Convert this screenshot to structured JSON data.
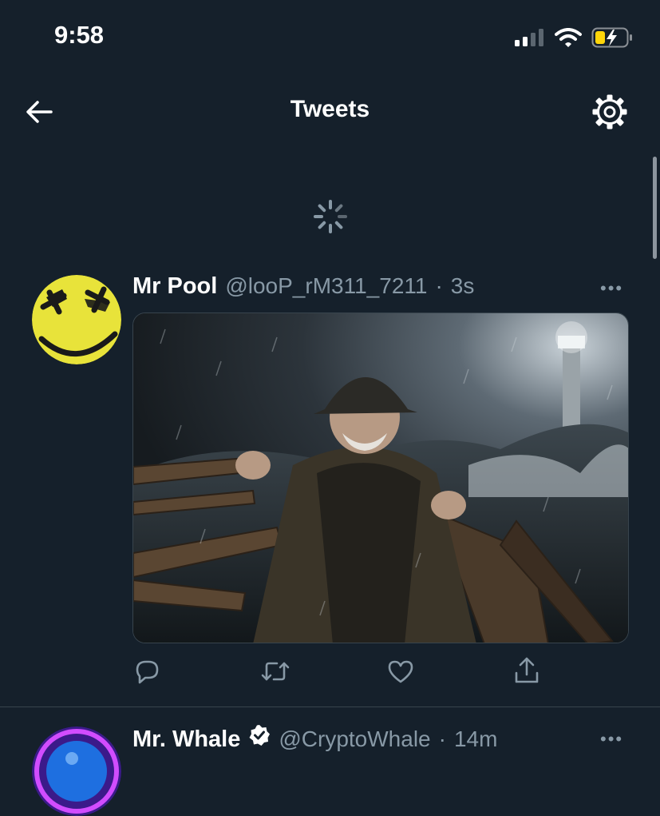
{
  "status_bar": {
    "time": "9:58",
    "signal_icon": "signal-bars-icon",
    "wifi_icon": "wifi-icon",
    "battery_icon": "battery-charging-icon",
    "battery_color": "#ffd60a"
  },
  "header": {
    "title": "Tweets",
    "back_icon": "back-arrow-icon",
    "settings_icon": "gear-icon"
  },
  "loading": {
    "icon": "loading-spinner-icon"
  },
  "tweets": [
    {
      "name": "Mr Pool",
      "handle": "@looP_rM311_7211",
      "separator": "·",
      "time": "3s",
      "more": "•••",
      "avatar_color": "#e8e33a",
      "media": "photo-fisherman-rowing-boat-in-storm"
    },
    {
      "name": "Mr. Whale",
      "handle": "@CryptoWhale",
      "separator": "·",
      "time": "14m",
      "more": "•••",
      "verified": true
    }
  ],
  "actions": {
    "reply_icon": "reply-icon",
    "retweet_icon": "retweet-icon",
    "like_icon": "heart-icon",
    "share_icon": "share-icon"
  },
  "colors": {
    "background": "#15202b",
    "secondary_text": "#8899a6",
    "divider": "#38444d"
  }
}
